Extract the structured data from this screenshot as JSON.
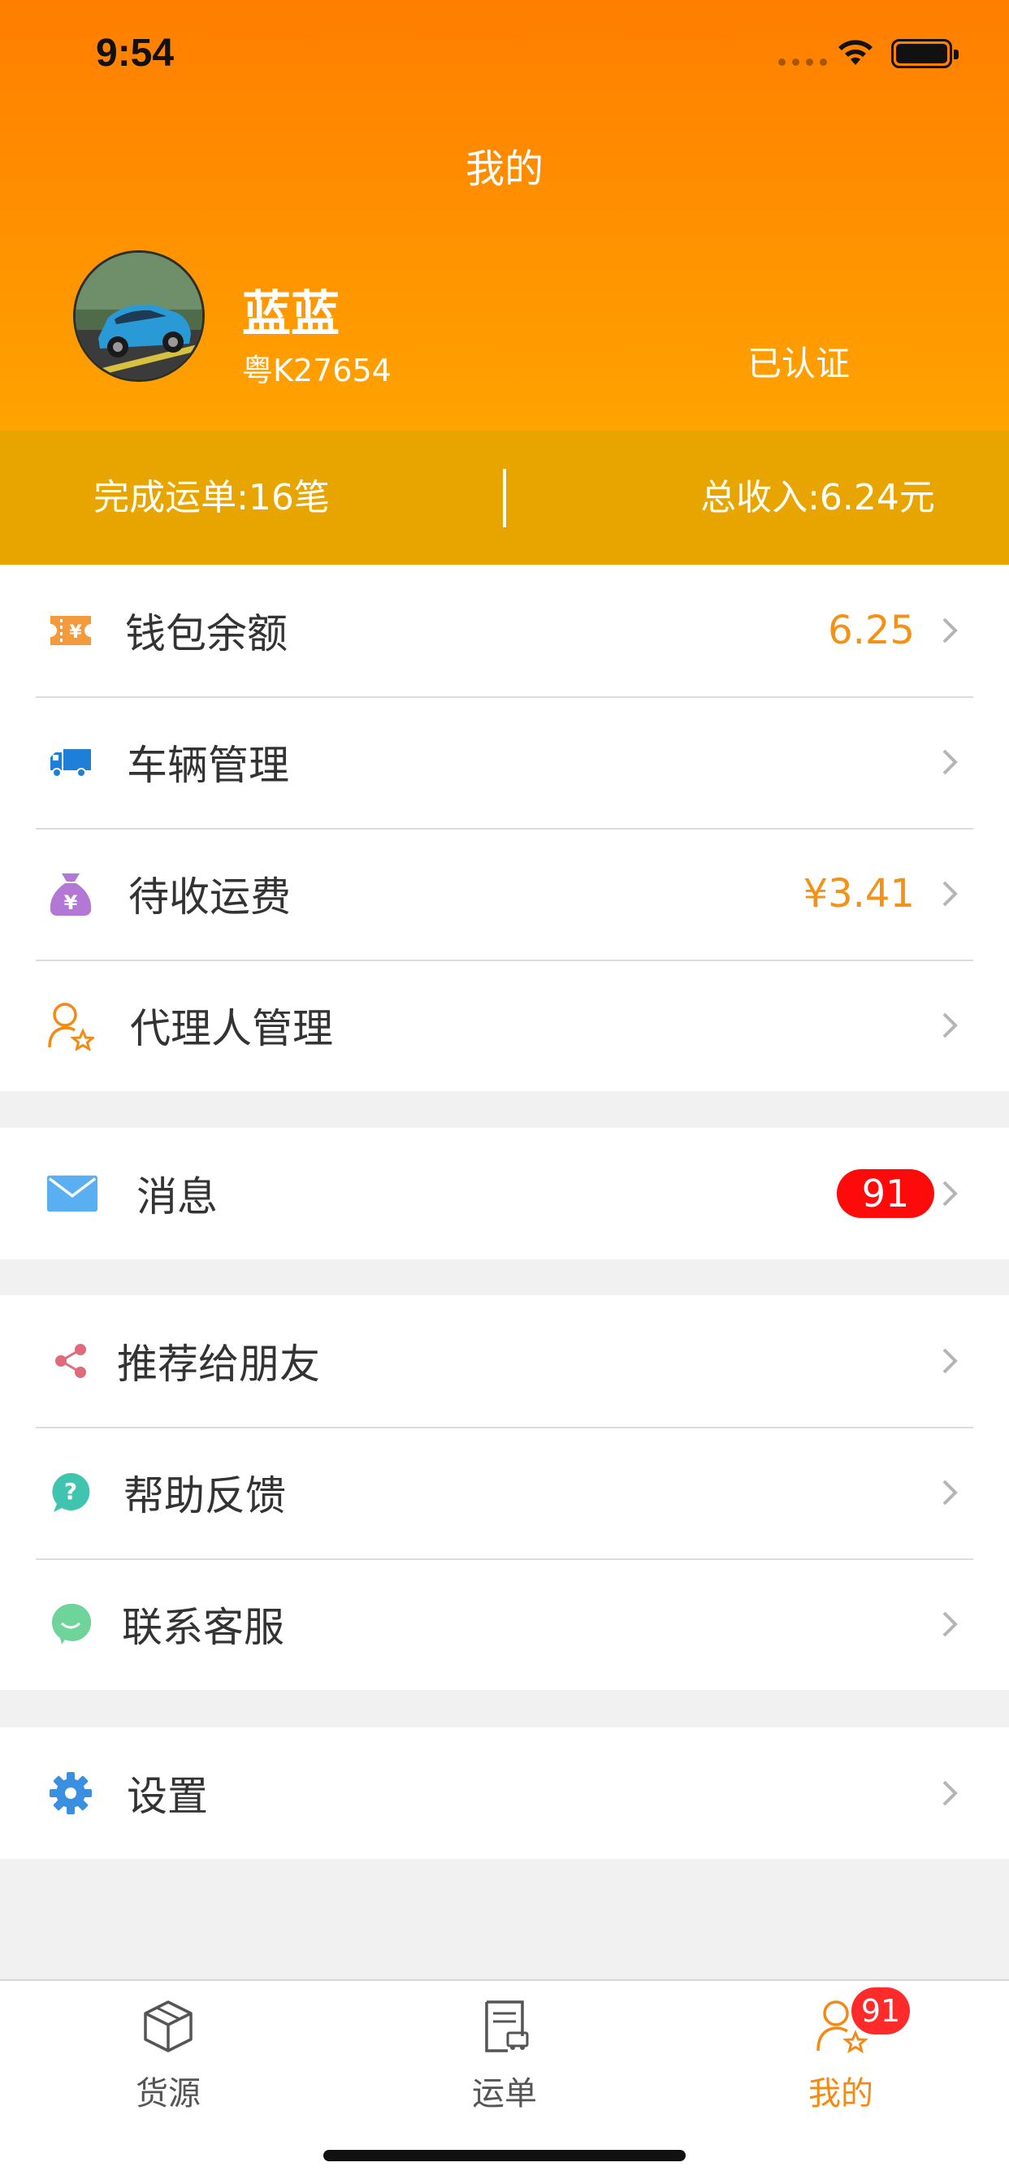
{
  "status_bar": {
    "time": "9:54"
  },
  "header": {
    "title": "我的",
    "user_name": "蓝蓝",
    "plate": "粤K27654",
    "verified": "已认证"
  },
  "stats": {
    "completed_orders": "完成运单:16笔",
    "total_income": "总收入:6.24元"
  },
  "group1": [
    {
      "label": "钱包余额",
      "value": "6.25",
      "icon": "wallet-icon",
      "color": "#f39214"
    },
    {
      "label": "车辆管理",
      "value": "",
      "icon": "truck-icon",
      "color": "#1f7fd8"
    },
    {
      "label": "待收运费",
      "value": "¥3.41",
      "icon": "money-bag-icon",
      "color": "#b377d6"
    },
    {
      "label": "代理人管理",
      "value": "",
      "icon": "agent-icon",
      "color": "#f38a14"
    }
  ],
  "group2": [
    {
      "label": "消息",
      "badge": "91",
      "icon": "mail-icon",
      "color": "#4aa8f0"
    }
  ],
  "group3": [
    {
      "label": "推荐给朋友",
      "icon": "share-icon",
      "color": "#e06a7a"
    },
    {
      "label": "帮助反馈",
      "icon": "help-icon",
      "color": "#3fc4b0"
    },
    {
      "label": "联系客服",
      "icon": "chat-icon",
      "color": "#5fd08e"
    }
  ],
  "group4": [
    {
      "label": "设置",
      "icon": "gear-icon",
      "color": "#3a8fe0"
    }
  ],
  "tabbar": {
    "items": [
      {
        "label": "货源",
        "icon": "box-icon"
      },
      {
        "label": "运单",
        "icon": "waybill-icon"
      },
      {
        "label": "我的",
        "icon": "profile-icon",
        "active": true
      }
    ],
    "badge": "91"
  }
}
